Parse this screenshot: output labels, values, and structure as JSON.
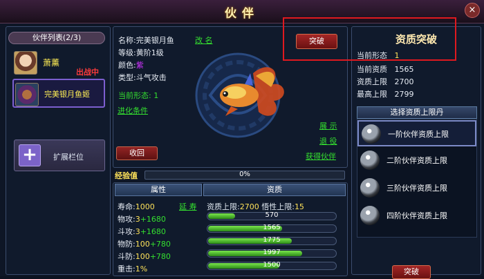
{
  "window": {
    "title": "伙伴",
    "close_glyph": "×"
  },
  "partner_list": {
    "header": "伙伴列表(2/3)",
    "partners": [
      {
        "name": "萧薰",
        "status": "出战中"
      },
      {
        "name": "完美银月鱼姬"
      }
    ],
    "expand_label": "扩展栏位",
    "expand_glyph": "+"
  },
  "info": {
    "name_key": "名称:",
    "name_val": "完美银月鱼",
    "rename": "改 名",
    "level_key": "等级:",
    "level_val": "黄阶1级",
    "color_key": "颜色:",
    "color_val": "紫",
    "type_key": "类型:",
    "type_val": "斗气攻击",
    "form_key": "当前形态:",
    "form_val": "1",
    "evolve_link": "进化条件"
  },
  "actions": {
    "breakthrough": "突破",
    "show": "展 示",
    "release": "退 役",
    "get_partner": "获得伙伴",
    "recall": "收回"
  },
  "exp": {
    "label": "经验值",
    "percent_text": "0%",
    "progress": 0
  },
  "stats_header": {
    "attr": "属性",
    "quality": "资质"
  },
  "stats": [
    {
      "key": "寿命:",
      "val": "1000",
      "bonus": "",
      "link": "延 寿"
    },
    {
      "key": "物攻:",
      "val": "3",
      "bonus": "+1680"
    },
    {
      "key": "斗攻:",
      "val": "3",
      "bonus": "+1680"
    },
    {
      "key": "物防:",
      "val": "100",
      "bonus": "+780"
    },
    {
      "key": "斗防:",
      "val": "100",
      "bonus": "+780"
    },
    {
      "key": "重击:",
      "val": "1%",
      "bonus": ""
    }
  ],
  "quality_limits": {
    "key1": "资质上限:",
    "val1": "2700",
    "key2": "悟性上限:",
    "val2": "15"
  },
  "quality_bars": [
    {
      "value": "570",
      "fill": 0.21
    },
    {
      "value": "1565",
      "fill": 0.58
    },
    {
      "value": "1775",
      "fill": 0.66
    },
    {
      "value": "1997",
      "fill": 0.74
    },
    {
      "value": "1500",
      "fill": 0.56
    }
  ],
  "breakthrough_panel": {
    "title": "资质突破",
    "current_form_key": "当前形态",
    "current_form_val": "1",
    "current_quality_key": "当前资质",
    "current_quality_val": "1565",
    "quality_cap_key": "资质上限",
    "quality_cap_val": "2700",
    "max_cap_key": "最高上限",
    "max_cap_val": "2799",
    "select_header": "选择资质上限丹",
    "pills": [
      {
        "label": "一阶伙伴资质上限"
      },
      {
        "label": "二阶伙伴资质上限"
      },
      {
        "label": "三阶伙伴资质上限"
      },
      {
        "label": "四阶伙伴资质上限"
      }
    ],
    "button": "突破"
  }
}
